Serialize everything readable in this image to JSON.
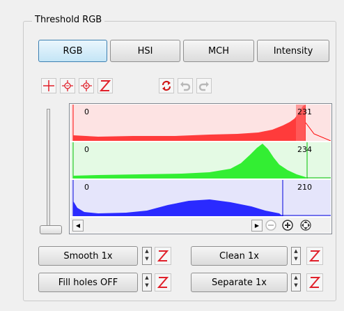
{
  "group": {
    "title": "Threshold RGB"
  },
  "mode_tabs": [
    {
      "label": "RGB",
      "active": true
    },
    {
      "label": "HSI",
      "active": false
    },
    {
      "label": "MCH",
      "active": false
    },
    {
      "label": "Intensity",
      "active": false
    }
  ],
  "toolbar": {
    "icons": [
      "crosshair-icon",
      "crosshair-minus-icon",
      "crosshair-plus-icon",
      "reset-icon",
      "refresh-icon",
      "undo-icon",
      "redo-icon"
    ]
  },
  "histograms": [
    {
      "channel": "red",
      "min_label": "0",
      "max_label": "231",
      "min": 0,
      "max": 231,
      "color": "#ff0000",
      "fill": "#ff3b3b",
      "bg": "#fde3e3"
    },
    {
      "channel": "green",
      "min_label": "0",
      "max_label": "234",
      "min": 0,
      "max": 234,
      "color": "#00c000",
      "fill": "#33ee33",
      "bg": "#e4fae4"
    },
    {
      "channel": "blue",
      "min_label": "0",
      "max_label": "210",
      "min": 0,
      "max": 210,
      "color": "#0000dd",
      "fill": "#2a2aff",
      "bg": "#e5e5fb"
    }
  ],
  "bottom_controls": {
    "smooth": "Smooth 1x",
    "clean": "Clean 1x",
    "fill_holes": "Fill holes OFF",
    "separate": "Separate 1x"
  },
  "colors": {
    "accent": "#3c7fb1",
    "reset_red": "#e0202a"
  }
}
